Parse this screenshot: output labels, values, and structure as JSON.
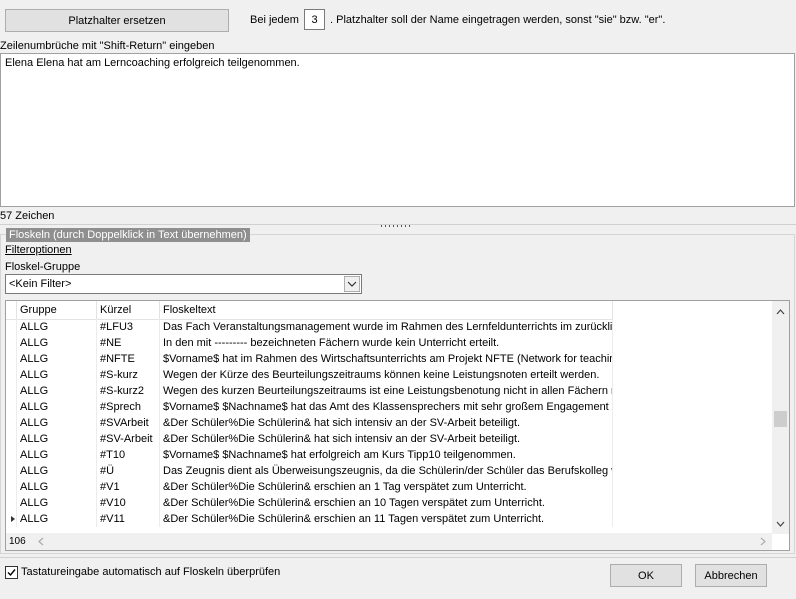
{
  "toolbar": {
    "replace_button": "Platzhalter ersetzen",
    "every_prefix": "Bei jedem",
    "every_value": "3",
    "every_suffix": ". Platzhalter soll der Name eingetragen werden, sonst \"sie\" bzw. \"er\"."
  },
  "editor": {
    "hint": "Zeilenumbrüche mit \"Shift-Return\" eingeben",
    "text": "Elena Elena hat am Lerncoaching erfolgreich teilgenommen.",
    "char_count": "57 Zeichen"
  },
  "phrases": {
    "group_title": "Floskeln (durch Doppelklick in Text übernehmen)",
    "filter_options": "Filteroptionen",
    "group_label": "Floskel-Gruppe",
    "group_value": "<Kein Filter>",
    "columns": [
      "Gruppe",
      "Kürzel",
      "Floskeltext"
    ],
    "rows": [
      [
        "ALLG",
        "#LFU3",
        "Das Fach Veranstaltungsmanagement wurde im Rahmen des Lernfeldunterrichts im zurückliege"
      ],
      [
        "ALLG",
        "#NE",
        "In den mit --------- bezeichneten Fächern wurde kein Unterricht erteilt."
      ],
      [
        "ALLG",
        "#NFTE",
        "$Vorname$ hat im Rahmen des Wirtschaftsunterrichts am Projekt NFTE (Network for teaching"
      ],
      [
        "ALLG",
        "#S-kurz",
        "Wegen der Kürze des Beurteilungszeitraums können keine Leistungsnoten erteilt werden."
      ],
      [
        "ALLG",
        "#S-kurz2",
        "Wegen des kurzen Beurteilungszeitraums ist eine Leistungsbenotung nicht in allen Fächern mö"
      ],
      [
        "ALLG",
        "#Sprech",
        "$Vorname$ $Nachname$ hat das Amt des Klassensprechers mit sehr großem Engagement übe"
      ],
      [
        "ALLG",
        "#SVArbeit",
        "&Der Schüler%Die Schülerin& hat sich intensiv an der SV-Arbeit beteiligt."
      ],
      [
        "ALLG",
        "#SV-Arbeit",
        "&Der Schüler%Die Schülerin& hat sich intensiv an der SV-Arbeit beteiligt."
      ],
      [
        "ALLG",
        "#T10",
        "$Vorname$ $Nachname$ hat erfolgreich am Kurs Tipp10 teilgenommen."
      ],
      [
        "ALLG",
        "#Ü",
        "Das Zeugnis dient als Überweisungszeugnis, da die Schülerin/der Schüler das Berufskolleg we"
      ],
      [
        "ALLG",
        "#V1",
        "&Der Schüler%Die Schülerin& erschien an 1 Tag verspätet zum Unterricht."
      ],
      [
        "ALLG",
        "#V10",
        "&Der Schüler%Die Schülerin& erschien an 10 Tagen verspätet zum Unterricht."
      ],
      [
        "ALLG",
        "#V11",
        "&Der Schüler%Die Schülerin& erschien an 11 Tagen verspätet zum Unterricht."
      ]
    ],
    "row_count": "106"
  },
  "footer": {
    "auto_check_label": "Tastatureingabe automatisch auf Floskeln überprüfen",
    "auto_check_checked": true,
    "ok": "OK",
    "cancel": "Abbrechen"
  },
  "icons": {
    "dropdown": "chevron-down-icon",
    "scroll_up": "chevron-up-icon",
    "scroll_down": "chevron-down-icon",
    "scroll_left": "chevron-left-icon",
    "scroll_right": "chevron-right-icon",
    "current_row": "triangle-right-icon",
    "check": "checkmark-icon"
  }
}
